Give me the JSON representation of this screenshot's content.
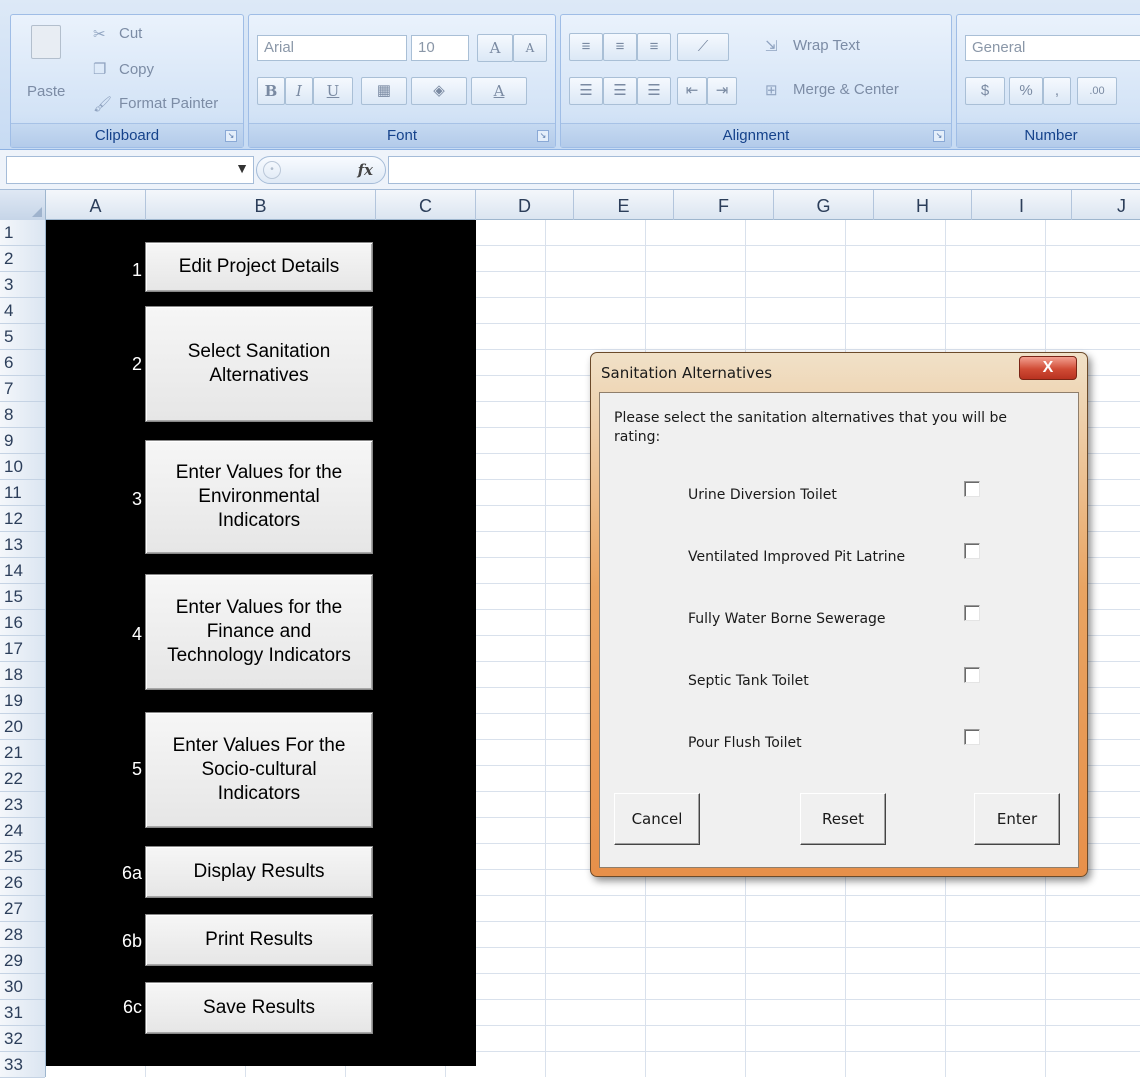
{
  "ribbon": {
    "clipboard": {
      "paste": "Paste",
      "cut": "Cut",
      "copy": "Copy",
      "format_painter": "Format Painter",
      "label": "Clipboard"
    },
    "font": {
      "font_name": "Arial",
      "font_size": "10",
      "bold": "B",
      "italic": "I",
      "underline": "U",
      "grow": "A",
      "shrink": "A",
      "font_color": "A",
      "label": "Font"
    },
    "alignment": {
      "wrap_text": "Wrap Text",
      "merge_center": "Merge & Center",
      "label": "Alignment"
    },
    "number": {
      "format": "General",
      "percent": "%",
      "comma": ",",
      "label": "Number"
    }
  },
  "formula_bar": {
    "fx": "fx"
  },
  "columns": [
    "A",
    "B",
    "C",
    "D",
    "E",
    "F",
    "G",
    "H",
    "I",
    "J"
  ],
  "rows": [
    "1",
    "2",
    "3",
    "4",
    "5",
    "6",
    "7",
    "8",
    "9",
    "10",
    "11",
    "12",
    "13",
    "14",
    "15",
    "16",
    "17",
    "18",
    "19",
    "20",
    "21",
    "22",
    "23",
    "24",
    "25",
    "26",
    "27",
    "28",
    "29",
    "30",
    "31",
    "32",
    "33"
  ],
  "panel": {
    "buttons": [
      {
        "num": "1",
        "label": "Edit Project Details"
      },
      {
        "num": "2",
        "label": "Select Sanitation\nAlternatives"
      },
      {
        "num": "3",
        "label": "Enter Values for the\nEnvironmental\nIndicators"
      },
      {
        "num": "4",
        "label": "Enter Values for the\nFinance and\nTechnology Indicators"
      },
      {
        "num": "5",
        "label": "Enter Values For the\nSocio-cultural\nIndicators"
      },
      {
        "num": "6a",
        "label": "Display Results"
      },
      {
        "num": "6b",
        "label": "Print Results"
      },
      {
        "num": "6c",
        "label": "Save Results"
      }
    ]
  },
  "dialog": {
    "title": "Sanitation Alternatives",
    "close": "X",
    "prompt": "Please select the sanitation alternatives that you will be rating:",
    "options": [
      {
        "label": "Urine Diversion Toilet",
        "checked": false
      },
      {
        "label": "Ventilated Improved Pit Latrine",
        "checked": false
      },
      {
        "label": "Fully Water Borne Sewerage",
        "checked": false
      },
      {
        "label": "Septic Tank Toilet",
        "checked": false
      },
      {
        "label": "Pour Flush Toilet",
        "checked": false
      }
    ],
    "buttons": {
      "cancel": "Cancel",
      "reset": "Reset",
      "enter": "Enter"
    }
  }
}
